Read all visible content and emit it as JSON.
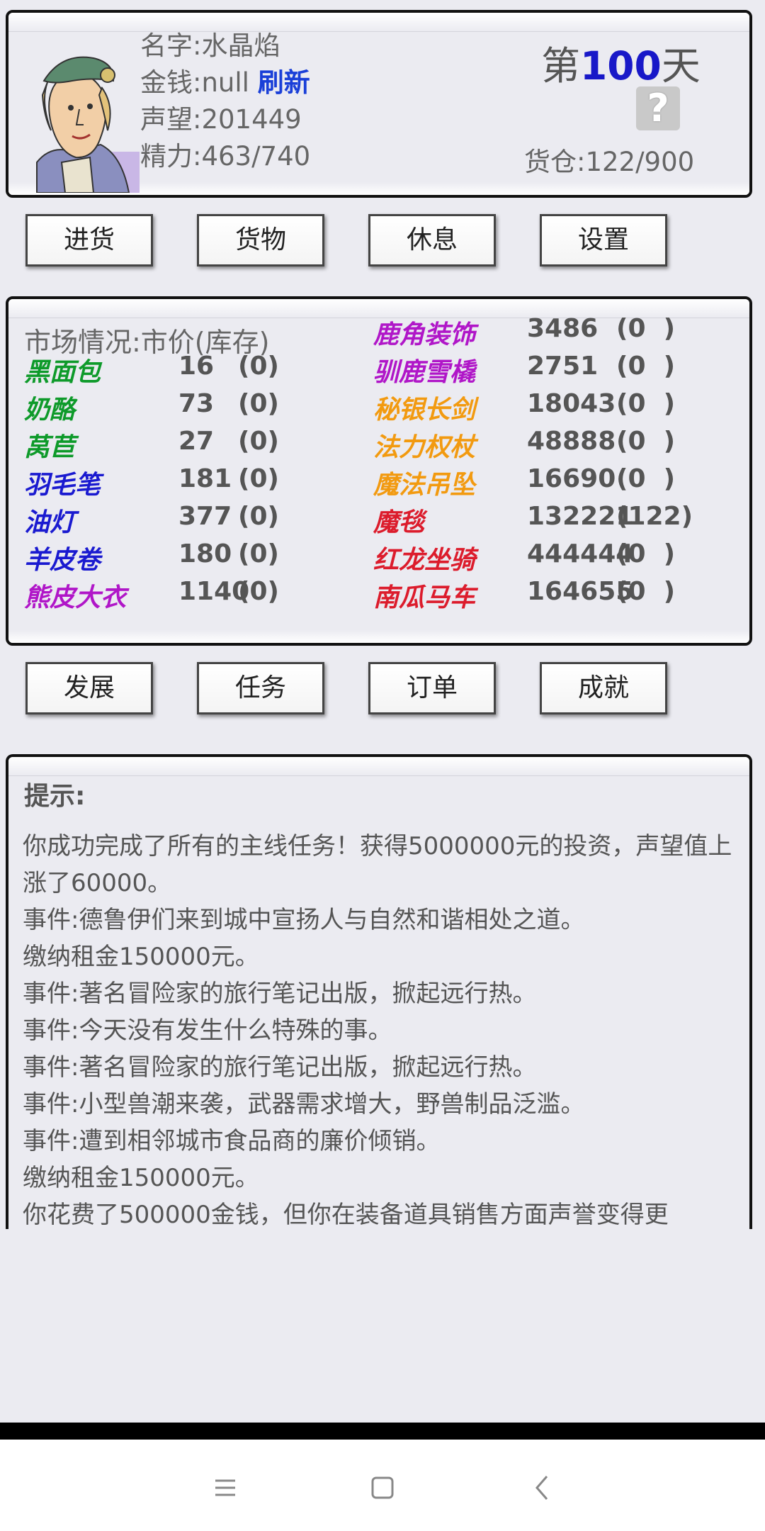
{
  "header": {
    "name_label": "名字:水晶焰",
    "money_label": "金钱:null",
    "refresh_label": "刷新",
    "reputation_label": "声望:201449",
    "energy_label": "精力:463/740",
    "day_prefix": "第",
    "day_number": "100",
    "day_suffix": "天",
    "help_symbol": "?",
    "warehouse_label": "货仓:122/900"
  },
  "top_buttons": [
    "进货",
    "货物",
    "休息",
    "设置"
  ],
  "market": {
    "header": "市场情况:市价(库存)",
    "left": [
      {
        "name": "黑面包",
        "price": "16",
        "stock": "(0)",
        "color": "#0e9a2a"
      },
      {
        "name": "奶酪",
        "price": "73",
        "stock": "(0)",
        "color": "#0e9a2a"
      },
      {
        "name": "莴苣",
        "price": "27",
        "stock": "(0)",
        "color": "#0e9a2a"
      },
      {
        "name": "羽毛笔",
        "price": "181",
        "stock": "(0)",
        "color": "#1a1ad0"
      },
      {
        "name": "油灯",
        "price": "377",
        "stock": "(0)",
        "color": "#1a1ad0"
      },
      {
        "name": "羊皮卷",
        "price": "180",
        "stock": "(0)",
        "color": "#1a1ad0"
      },
      {
        "name": "熊皮大衣",
        "price": "1140",
        "stock": "(0)",
        "color": "#b016c8"
      }
    ],
    "right": [
      {
        "name": "鹿角装饰",
        "price": "3486",
        "stock": "(0  )",
        "color": "#b016c8"
      },
      {
        "name": "驯鹿雪橇",
        "price": "2751",
        "stock": "(0  )",
        "color": "#b016c8"
      },
      {
        "name": "秘银长剑",
        "price": "18043",
        "stock": "(0  )",
        "color": "#f29a10"
      },
      {
        "name": "法力权杖",
        "price": "48888",
        "stock": "(0  )",
        "color": "#f29a10"
      },
      {
        "name": "魔法吊坠",
        "price": "16690",
        "stock": "(0  )",
        "color": "#f29a10"
      },
      {
        "name": "魔毯",
        "price": "132221",
        "stock": "(122)",
        "color": "#dc1c2c"
      },
      {
        "name": "红龙坐骑",
        "price": "444444",
        "stock": "(0  )",
        "color": "#dc1c2c"
      },
      {
        "name": "南瓜马车",
        "price": "164655",
        "stock": "(0  )",
        "color": "#dc1c2c"
      }
    ]
  },
  "bottom_buttons": [
    "发展",
    "任务",
    "订单",
    "成就"
  ],
  "tips": {
    "title": "提示:",
    "lines": [
      "你成功完成了所有的主线任务！获得5000000元的投资，声望值上涨了60000。",
      "事件:德鲁伊们来到城中宣扬人与自然和谐相处之道。",
      "缴纳租金150000元。",
      "事件:著名冒险家的旅行笔记出版，掀起远行热。",
      "事件:今天没有发生什么特殊的事。",
      "事件:著名冒险家的旅行笔记出版，掀起远行热。",
      "事件:小型兽潮来袭，武器需求增大，野兽制品泛滥。",
      "事件:遭到相邻城市食品商的廉价倾销。",
      "缴纳租金150000元。",
      "你花费了500000金钱，但你在装备道具销售方面声誉变得更"
    ]
  },
  "icons": {
    "menu": "menu-icon",
    "home": "home-icon",
    "back": "back-icon"
  }
}
